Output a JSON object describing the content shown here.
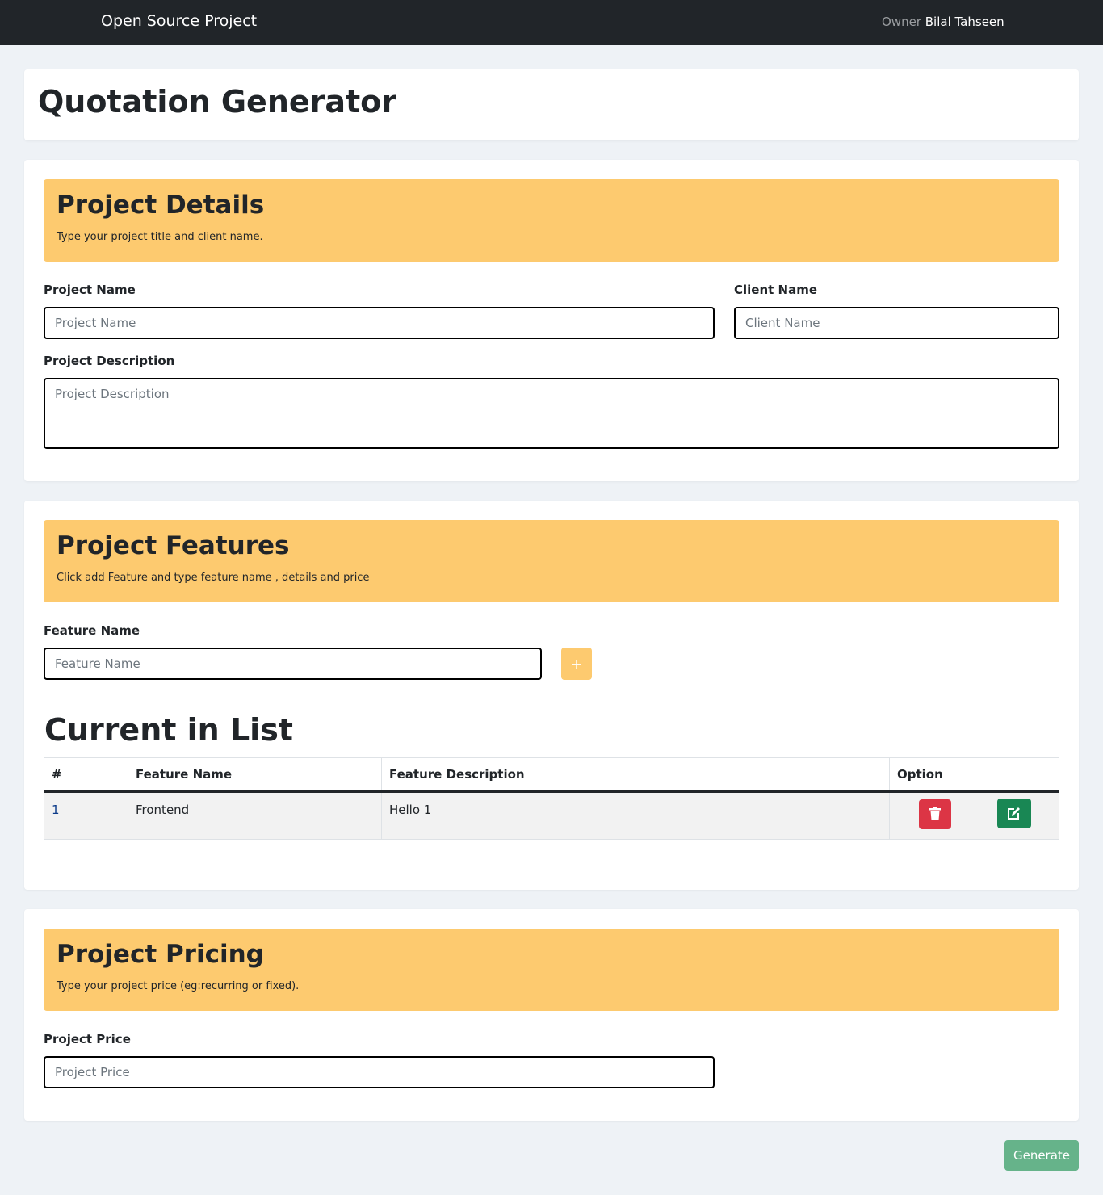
{
  "nav": {
    "brand": "Open Source Project",
    "owner_label": "Owner",
    "owner_name": " Bilal Tahseen"
  },
  "page_title": "Quotation Generator",
  "details": {
    "title": "Project Details",
    "subtitle": "Type your project title and client name.",
    "project_name_label": "Project Name",
    "project_name_placeholder": "Project Name",
    "client_name_label": "Client Name",
    "client_name_placeholder": "Client Name",
    "description_label": "Project Description",
    "description_placeholder": "Project Description"
  },
  "features": {
    "title": "Project Features",
    "subtitle": "Click add Feature and type feature name , details and price",
    "feature_name_label": "Feature Name",
    "feature_name_placeholder": "Feature Name",
    "add_label": "+",
    "list_title": "Current in List",
    "columns": [
      "#",
      "Feature Name",
      "Feature Description",
      "Option"
    ],
    "rows": [
      {
        "num": "1",
        "name": "Frontend",
        "description": "Hello 1"
      }
    ]
  },
  "pricing": {
    "title": "Project Pricing",
    "subtitle": "Type your project price (eg:recurring or fixed).",
    "price_label": "Project Price",
    "price_placeholder": "Project Price"
  },
  "generate_label": "Generate"
}
